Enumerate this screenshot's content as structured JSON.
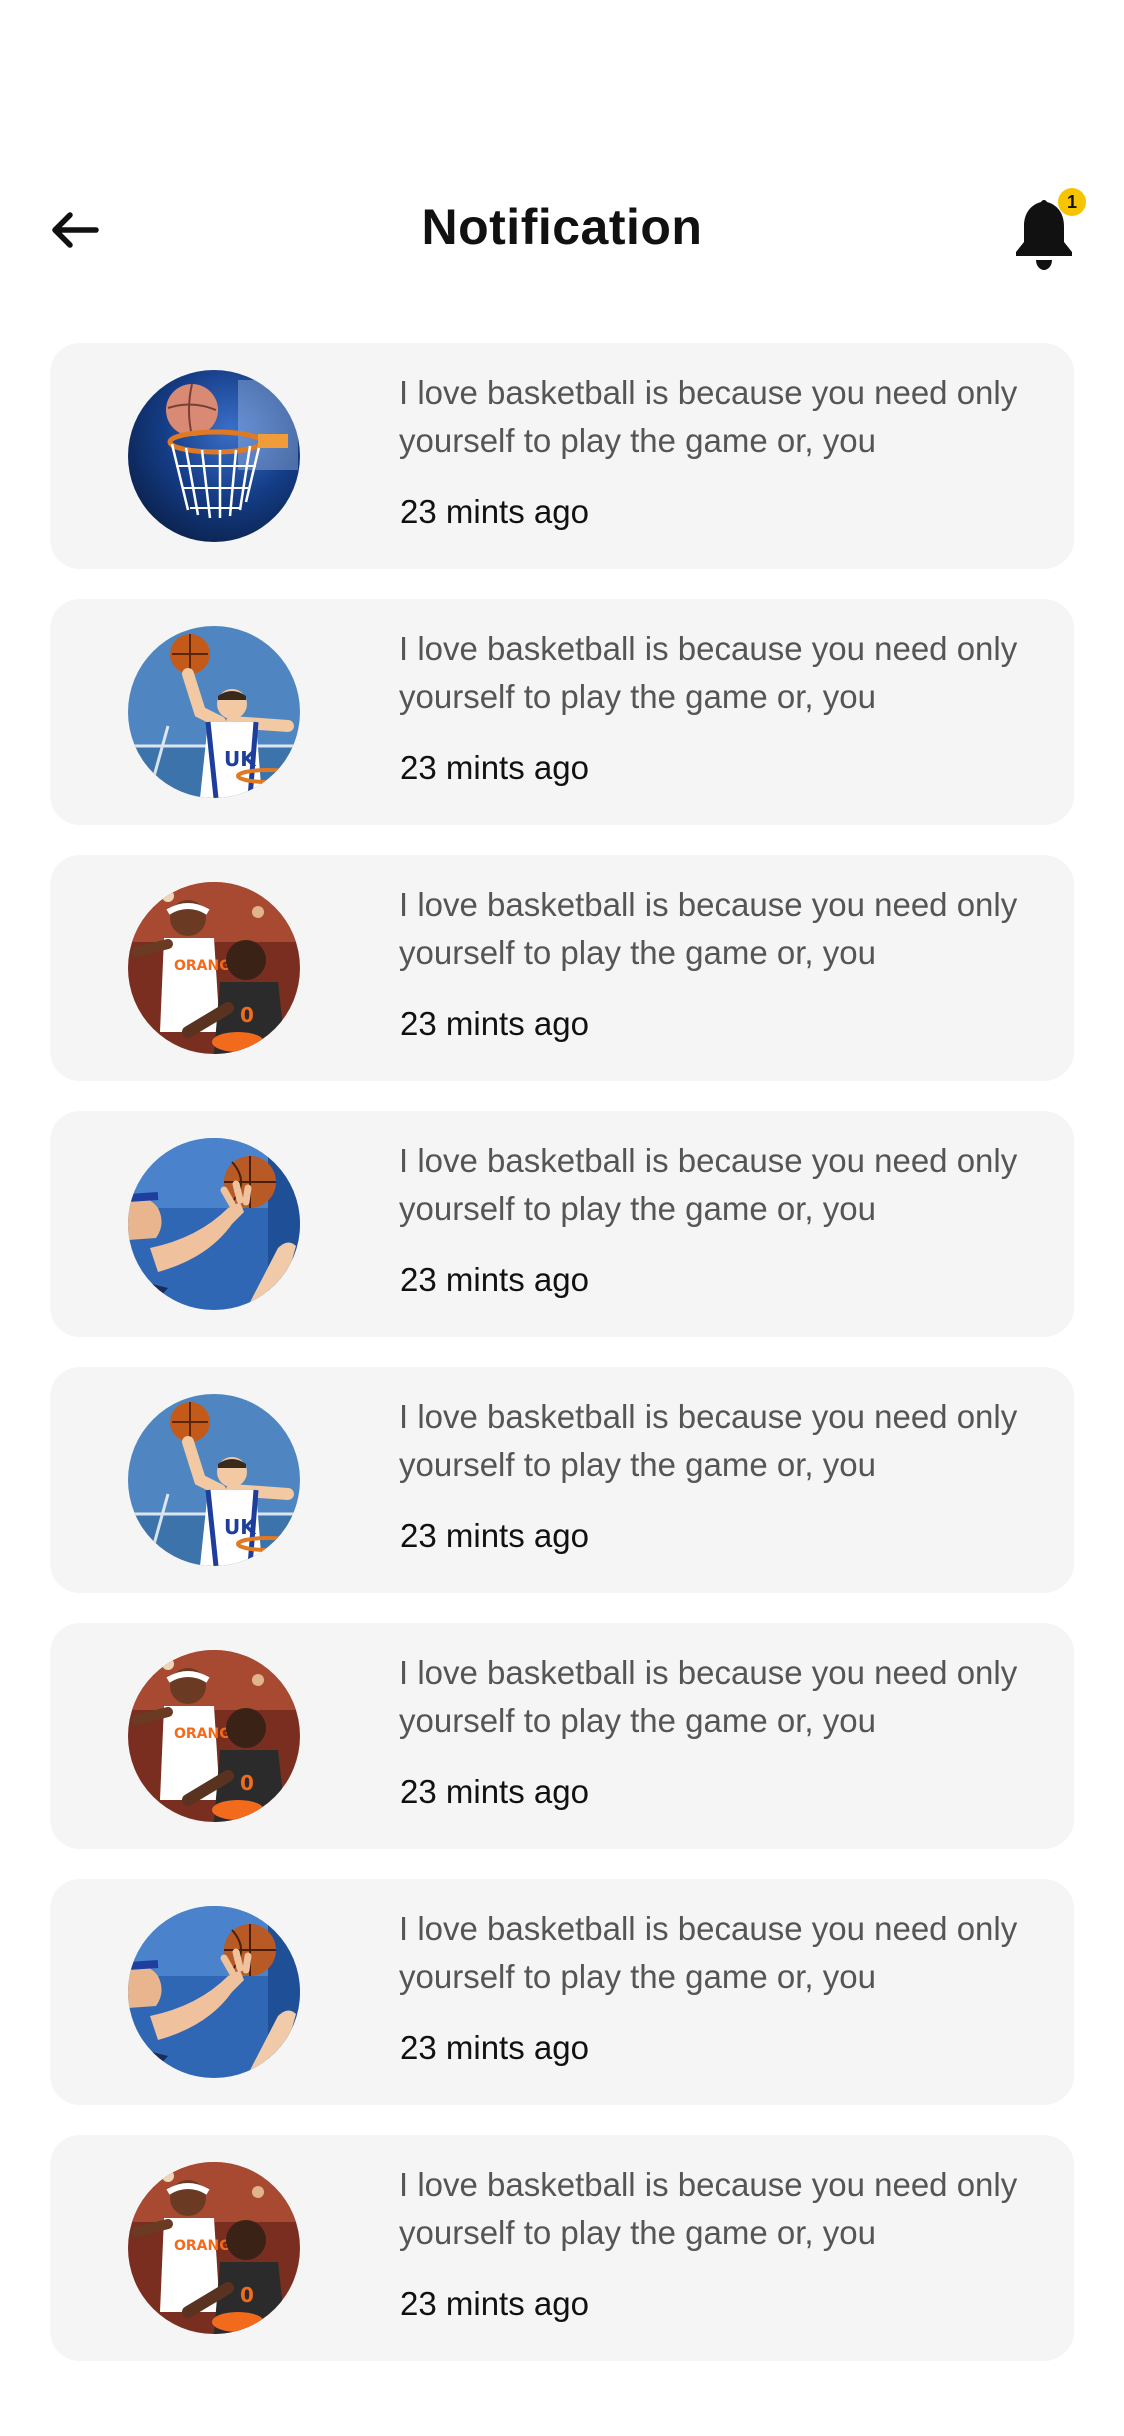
{
  "header": {
    "title": "Notification",
    "back_icon": "arrow-left-icon",
    "bell_icon": "bell-icon",
    "badge_count": "1",
    "badge_color": "#f6c400"
  },
  "notifications": [
    {
      "avatar": "basketball-hoop",
      "message": "I love basketball is because you need only yourself to play the game or, you",
      "time": "23 mints ago"
    },
    {
      "avatar": "player-dunk",
      "message": "I love basketball is because you need only yourself to play the game or, you",
      "time": "23 mints ago"
    },
    {
      "avatar": "players-game",
      "message": "I love basketball is because you need only yourself to play the game or, you",
      "time": "23 mints ago"
    },
    {
      "avatar": "player-hand",
      "message": "I love basketball is because you need only yourself to play the game or, you",
      "time": "23 mints ago"
    },
    {
      "avatar": "player-dunk",
      "message": "I love basketball is because you need only yourself to play the game or, you",
      "time": "23 mints ago"
    },
    {
      "avatar": "players-game",
      "message": "I love basketball is because you need only yourself to play the game or, you",
      "time": "23 mints ago"
    },
    {
      "avatar": "player-hand",
      "message": "I love basketball is because you need only yourself to play the game or, you",
      "time": "23 mints ago"
    },
    {
      "avatar": "players-game",
      "message": "I love basketball is because you need only yourself to play the game or, you",
      "time": "23 mints ago"
    }
  ]
}
